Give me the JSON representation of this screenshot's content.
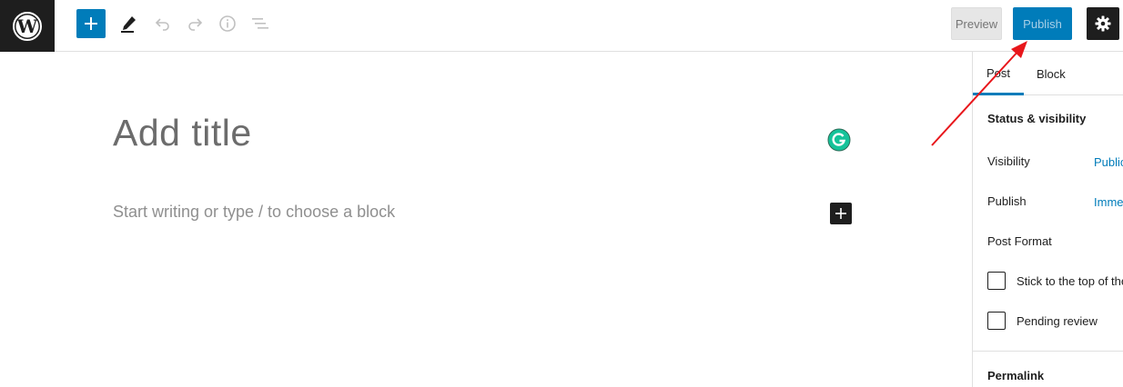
{
  "toolbar": {
    "logo_icon": "wordpress-logo",
    "add_block_icon": "plus-icon",
    "tools_icon": "pencil-icon",
    "undo_icon": "undo-icon",
    "redo_icon": "redo-icon",
    "info_icon": "info-icon",
    "outline_icon": "list-outline-icon",
    "preview_label": "Preview",
    "publish_label": "Publish",
    "settings_icon": "gear-icon"
  },
  "editor": {
    "title_placeholder": "Add title",
    "block_placeholder": "Start writing or type / to choose a block",
    "grammarly_icon": "grammarly-icon",
    "inserter_icon": "plus-icon"
  },
  "sidebar": {
    "tabs": [
      {
        "label": "Post",
        "active": true
      },
      {
        "label": "Block",
        "active": false
      }
    ],
    "status_section_title": "Status & visibility",
    "visibility_label": "Visibility",
    "visibility_value": "Public",
    "publish_label": "Publish",
    "publish_value": "Immediately",
    "post_format_label": "Post Format",
    "sticky_label": "Stick to the top of the blog",
    "pending_label": "Pending review",
    "permalink_title": "Permalink"
  },
  "colors": {
    "accent": "#007cba",
    "dark": "#1e1e1e",
    "annotation_arrow": "#e8161b",
    "grammarly": "#15c39a"
  }
}
